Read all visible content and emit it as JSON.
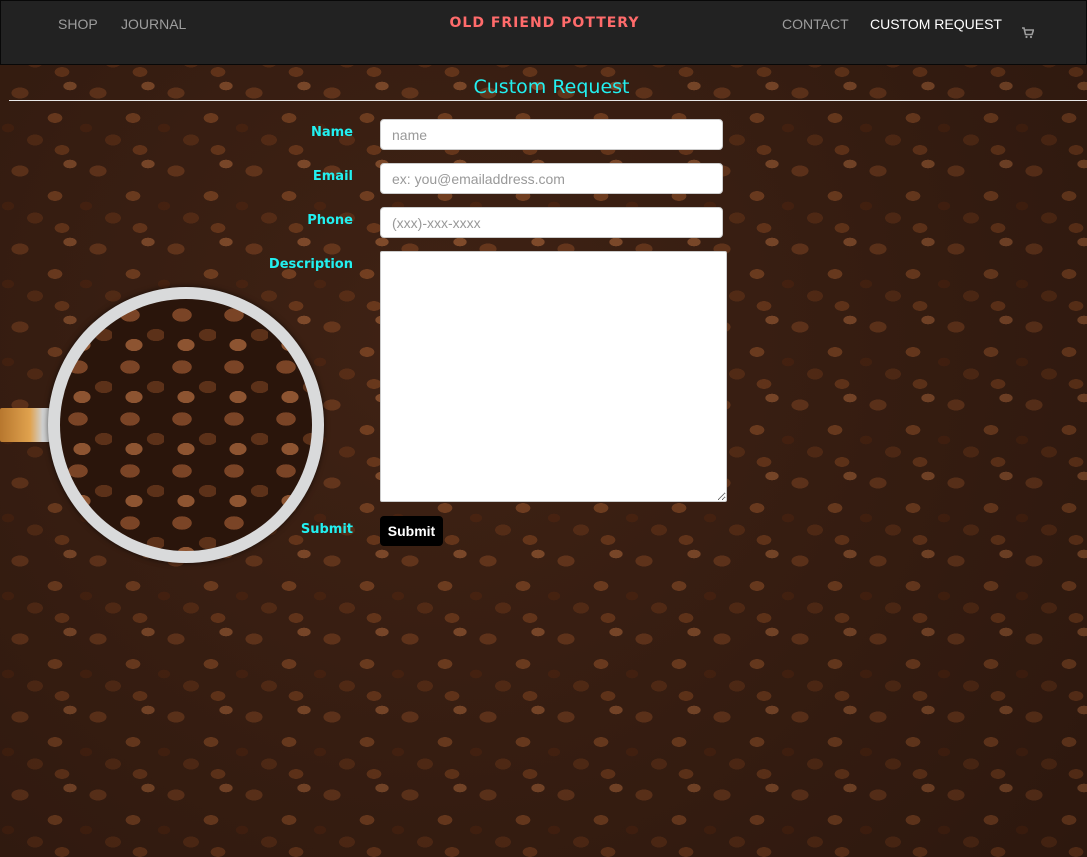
{
  "nav": {
    "left_links": [
      "SHOP",
      "JOURNAL"
    ],
    "brand": "OLD FRIEND POTTERY",
    "right_links": [
      "CONTACT",
      "CUSTOM REQUEST"
    ],
    "active_link": "CUSTOM REQUEST",
    "cart_icon": "shopping-cart-icon"
  },
  "page": {
    "title": "Custom Request"
  },
  "form": {
    "name": {
      "label": "Name",
      "placeholder": "name",
      "value": ""
    },
    "email": {
      "label": "Email",
      "placeholder": "ex: you@emailaddress.com",
      "value": ""
    },
    "phone": {
      "label": "Phone",
      "placeholder": "(xxx)-xxx-xxxx",
      "value": ""
    },
    "description": {
      "label": "Description",
      "value": ""
    },
    "submit": {
      "label": "Submit",
      "button_label": "Submit"
    }
  },
  "colors": {
    "navbar_bg": "#222222",
    "brand": "#ff6b6b",
    "accent_cyan": "#22f0f0",
    "nav_link": "#9d9d9d",
    "nav_active": "#ffffff",
    "submit_bg": "#000000"
  }
}
